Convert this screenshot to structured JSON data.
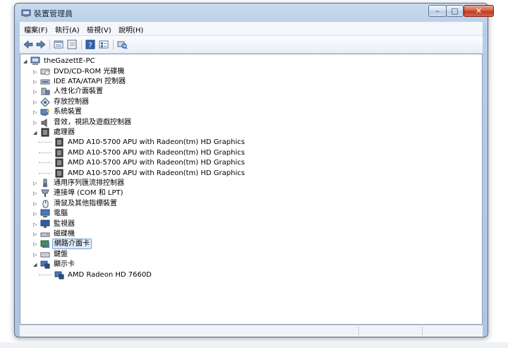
{
  "window": {
    "title": "裝置管理員",
    "buttons": {
      "minimize": "–",
      "maximize": "□",
      "close": "✕"
    }
  },
  "menu": [
    "檔案(F)",
    "執行(A)",
    "檢視(V)",
    "說明(H)"
  ],
  "toolbar_icons": [
    "back-icon",
    "forward-icon",
    "properties-icon",
    "show-hide-icon",
    "help-icon",
    "details-icon",
    "scan-hardware-icon"
  ],
  "tree": {
    "root": "theGazettE-PC",
    "nodes": [
      {
        "label": "DVD/CD-ROM 光碟機",
        "level": 1,
        "expander": "collapsed",
        "icon": "dvd-drive-icon"
      },
      {
        "label": "IDE ATA/ATAPI 控制器",
        "level": 1,
        "expander": "collapsed",
        "icon": "ide-controller-icon"
      },
      {
        "label": "人性化介面裝置",
        "level": 1,
        "expander": "collapsed",
        "icon": "hid-icon"
      },
      {
        "label": "存放控制器",
        "level": 1,
        "expander": "collapsed",
        "icon": "storage-controller-icon"
      },
      {
        "label": "系統裝置",
        "level": 1,
        "expander": "collapsed",
        "icon": "system-devices-icon"
      },
      {
        "label": "音效，視訊及遊戲控制器",
        "level": 1,
        "expander": "collapsed",
        "icon": "sound-icon"
      },
      {
        "label": "處理器",
        "level": 1,
        "expander": "expanded",
        "icon": "processor-icon"
      },
      {
        "label": "AMD A10-5700 APU with Radeon(tm) HD Graphics",
        "level": 2,
        "expander": "none",
        "icon": "processor-icon"
      },
      {
        "label": "AMD A10-5700 APU with Radeon(tm) HD Graphics",
        "level": 2,
        "expander": "none",
        "icon": "processor-icon"
      },
      {
        "label": "AMD A10-5700 APU with Radeon(tm) HD Graphics",
        "level": 2,
        "expander": "none",
        "icon": "processor-icon"
      },
      {
        "label": "AMD A10-5700 APU with Radeon(tm) HD Graphics",
        "level": 2,
        "expander": "none",
        "icon": "processor-icon"
      },
      {
        "label": "通用序列匯流排控制器",
        "level": 1,
        "expander": "collapsed",
        "icon": "usb-icon"
      },
      {
        "label": "連接埠 (COM 和 LPT)",
        "level": 1,
        "expander": "collapsed",
        "icon": "port-icon"
      },
      {
        "label": "滑鼠及其他指標裝置",
        "level": 1,
        "expander": "collapsed",
        "icon": "mouse-icon"
      },
      {
        "label": "電腦",
        "level": 1,
        "expander": "collapsed",
        "icon": "computer-icon"
      },
      {
        "label": "監視器",
        "level": 1,
        "expander": "collapsed",
        "icon": "monitor-icon"
      },
      {
        "label": "磁碟機",
        "level": 1,
        "expander": "collapsed",
        "icon": "disk-drive-icon"
      },
      {
        "label": "網路介面卡",
        "level": 1,
        "expander": "collapsed",
        "icon": "network-adapter-icon",
        "selected": true
      },
      {
        "label": "鍵盤",
        "level": 1,
        "expander": "collapsed",
        "icon": "keyboard-icon"
      },
      {
        "label": "顯示卡",
        "level": 1,
        "expander": "expanded",
        "icon": "display-adapter-icon"
      },
      {
        "label": "AMD Radeon HD 7660D",
        "level": 2,
        "expander": "none",
        "icon": "display-adapter-icon"
      }
    ]
  },
  "colors": {
    "selection_bg": "#dce9f8",
    "selection_border": "#7da2ce",
    "frame": "#aec6e3"
  }
}
